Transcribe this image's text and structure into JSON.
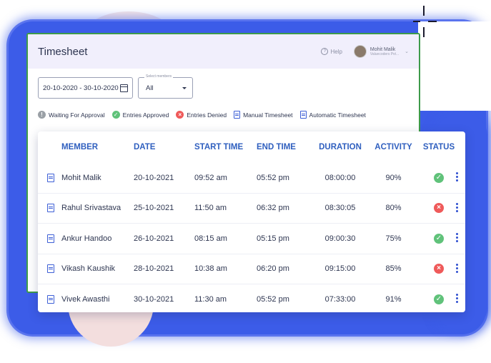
{
  "app": {
    "title": "Timesheet"
  },
  "header": {
    "help_label": "Help",
    "user_name": "Mohit Malik",
    "user_org": "Valuecoders Pvt..."
  },
  "filters": {
    "date_range": "20-10-2020 - 30-10-2020",
    "members_label": "Select members",
    "members_value": "All"
  },
  "legend": {
    "waiting": "Waiting For Approval",
    "approved": "Entries Approved",
    "denied": "Entries Denied",
    "manual": "Manual Timesheet",
    "automatic": "Automatic Timesheet"
  },
  "table": {
    "headers": [
      "MEMBER",
      "DATE",
      "START TIME",
      "END TIME",
      "DURATION",
      "ACTIVITY",
      "STATUS"
    ],
    "rows": [
      {
        "member": "Mohit Malik",
        "date": "20-10-2021",
        "start": "09:52 am",
        "end": "05:52 pm",
        "duration": "08:00:00",
        "activity": "90%",
        "status": "approved"
      },
      {
        "member": "Rahul Srivastava",
        "date": "25-10-2021",
        "start": "11:50 am",
        "end": "06:32 pm",
        "duration": "08:30:05",
        "activity": "80%",
        "status": "denied"
      },
      {
        "member": "Ankur Handoo",
        "date": "26-10-2021",
        "start": "08:15 am",
        "end": "05:15 pm",
        "duration": "09:00:30",
        "activity": "75%",
        "status": "approved"
      },
      {
        "member": "Vikash Kaushik",
        "date": "28-10-2021",
        "start": "10:38 am",
        "end": "06:20 pm",
        "duration": "09:15:00",
        "activity": "85%",
        "status": "denied"
      },
      {
        "member": "Vivek Awasthi",
        "date": "30-10-2021",
        "start": "11:30 am",
        "end": "05:52 pm",
        "duration": "07:33:00",
        "activity": "91%",
        "status": "approved"
      }
    ]
  },
  "colors": {
    "accent": "#2f5fbf",
    "approved": "#60c27a",
    "denied": "#ef5a5a",
    "backdrop": "#3c5ce8"
  }
}
